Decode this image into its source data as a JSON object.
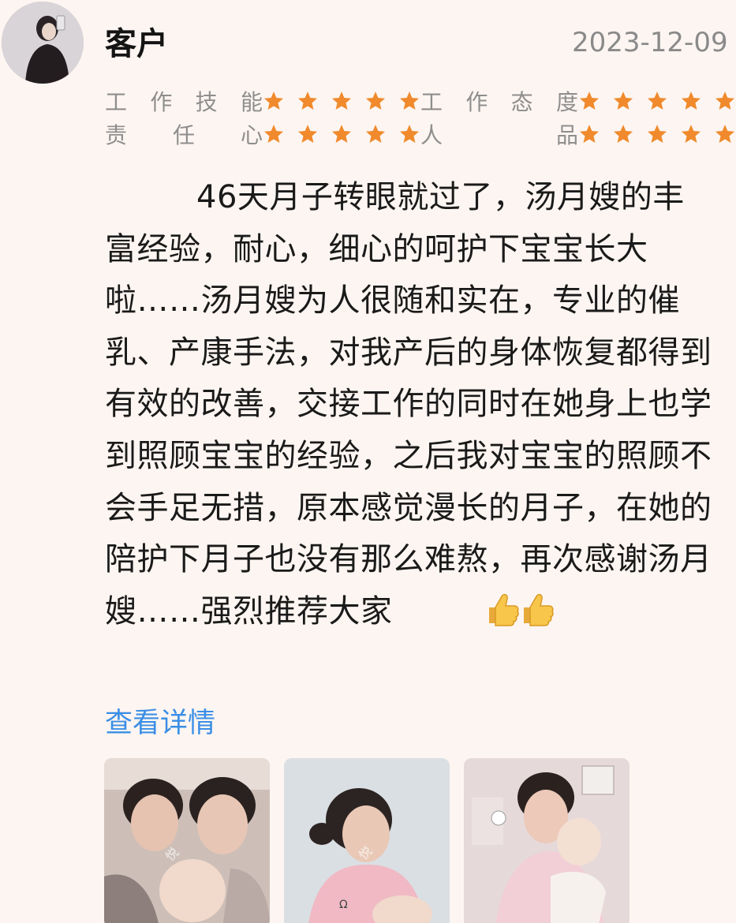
{
  "user": {
    "name": "客户",
    "date": "2023-12-09"
  },
  "ratings": [
    {
      "label_chars": [
        "工",
        "作",
        "技",
        "能"
      ],
      "label": "工作技能",
      "stars": 5
    },
    {
      "label_chars": [
        "工",
        "作",
        "态",
        "度"
      ],
      "label": "工作态度",
      "stars": 5
    },
    {
      "label_chars": [
        "责",
        "任",
        "心"
      ],
      "label": "责任心",
      "stars": 5
    },
    {
      "label_chars": [
        "人",
        "品"
      ],
      "label": "人品",
      "stars": 5
    }
  ],
  "review": {
    "text": "46天月子转眼就过了，汤月嫂的丰富经验，耐心，细心的呵护下宝宝长大啦……汤月嫂为人很随和实在，专业的催乳、产康手法，对我产后的身体恢复都得到有效的改善，交接工作的同时在她身上也学到照顾宝宝的经验，之后我对宝宝的照顾不会手足无措，原本感觉漫长的月子，在她的陪护下月子也没有那么难熬，再次感谢汤月嫂……强烈推荐大家",
    "emoji": "thumbs-up-icon x2"
  },
  "details_link": "查看详情",
  "photos": [
    {
      "name": "photo-1",
      "watermark": "悦"
    },
    {
      "name": "photo-2",
      "watermark": "悦"
    },
    {
      "name": "photo-3",
      "watermark": ""
    }
  ],
  "colors": {
    "background": "#fdf5f1",
    "star": "#f08a2c",
    "link": "#3a8ee6",
    "muted": "#8e8e8e"
  }
}
